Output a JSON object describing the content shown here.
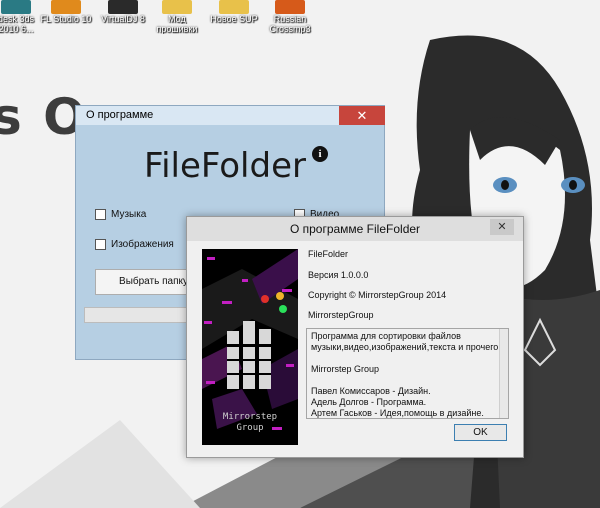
{
  "desktop": {
    "background_text": "s Oc",
    "icons": [
      {
        "label1": "desk 3ds",
        "label2": "2010 6...",
        "color": "#2a7a84"
      },
      {
        "label1": "FL Studio 10",
        "label2": "",
        "color": "#e08a1c"
      },
      {
        "label1": "VirtualDJ 8",
        "label2": "",
        "color": "#2a2a2a"
      },
      {
        "label1": "Мод",
        "label2": "прошивки",
        "color": "#e8c14a"
      },
      {
        "label1": "Новое SUP",
        "label2": "",
        "color": "#e8c14a"
      },
      {
        "label1": "Russian",
        "label2": "Crossmp3",
        "color": "#d65a1a"
      }
    ]
  },
  "main_window": {
    "title": "О программе",
    "close_glyph": "✕",
    "app_title": "FileFolder",
    "info_glyph": "i",
    "checkboxes": {
      "music": "Музыка",
      "images": "Изображения",
      "video": "Видео"
    },
    "choose_button": "Выбрать папку",
    "colors": {
      "window_bg": "#b6cfe3",
      "close_bg": "#c7453c"
    }
  },
  "about_window": {
    "title": "О программе FileFolder",
    "close_glyph": "✕",
    "logo_text_1": "Mirrorstep",
    "logo_text_2": "Group",
    "product": "FileFolder",
    "version": "Версия 1.0.0.0",
    "copyright": "Copyright © MirrorstepGroup  2014",
    "company": "MirrorstepGroup",
    "description": [
      "Программа для сортировки файлов",
      "музыки,видео,изображений,текста и прочего.",
      "",
      "Mirrorstep Group",
      "",
      "Павел Комиссаров - Дизайн.",
      "Адель Долгов - Программа.",
      "Артем Гаськов - Идея,помощь в дизайне."
    ],
    "ok_button": "OK",
    "colors": {
      "ok_border": "#3c7fb1"
    }
  }
}
